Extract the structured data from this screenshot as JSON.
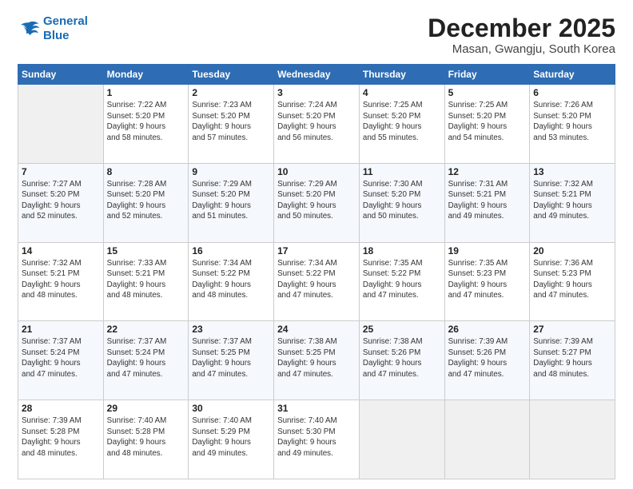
{
  "header": {
    "logo_line1": "General",
    "logo_line2": "Blue",
    "month": "December 2025",
    "location": "Masan, Gwangju, South Korea"
  },
  "days": [
    "Sunday",
    "Monday",
    "Tuesday",
    "Wednesday",
    "Thursday",
    "Friday",
    "Saturday"
  ],
  "weeks": [
    [
      {
        "date": "",
        "info": ""
      },
      {
        "date": "1",
        "info": "Sunrise: 7:22 AM\nSunset: 5:20 PM\nDaylight: 9 hours\nand 58 minutes."
      },
      {
        "date": "2",
        "info": "Sunrise: 7:23 AM\nSunset: 5:20 PM\nDaylight: 9 hours\nand 57 minutes."
      },
      {
        "date": "3",
        "info": "Sunrise: 7:24 AM\nSunset: 5:20 PM\nDaylight: 9 hours\nand 56 minutes."
      },
      {
        "date": "4",
        "info": "Sunrise: 7:25 AM\nSunset: 5:20 PM\nDaylight: 9 hours\nand 55 minutes."
      },
      {
        "date": "5",
        "info": "Sunrise: 7:25 AM\nSunset: 5:20 PM\nDaylight: 9 hours\nand 54 minutes."
      },
      {
        "date": "6",
        "info": "Sunrise: 7:26 AM\nSunset: 5:20 PM\nDaylight: 9 hours\nand 53 minutes."
      }
    ],
    [
      {
        "date": "7",
        "info": "Sunrise: 7:27 AM\nSunset: 5:20 PM\nDaylight: 9 hours\nand 52 minutes."
      },
      {
        "date": "8",
        "info": "Sunrise: 7:28 AM\nSunset: 5:20 PM\nDaylight: 9 hours\nand 52 minutes."
      },
      {
        "date": "9",
        "info": "Sunrise: 7:29 AM\nSunset: 5:20 PM\nDaylight: 9 hours\nand 51 minutes."
      },
      {
        "date": "10",
        "info": "Sunrise: 7:29 AM\nSunset: 5:20 PM\nDaylight: 9 hours\nand 50 minutes."
      },
      {
        "date": "11",
        "info": "Sunrise: 7:30 AM\nSunset: 5:20 PM\nDaylight: 9 hours\nand 50 minutes."
      },
      {
        "date": "12",
        "info": "Sunrise: 7:31 AM\nSunset: 5:21 PM\nDaylight: 9 hours\nand 49 minutes."
      },
      {
        "date": "13",
        "info": "Sunrise: 7:32 AM\nSunset: 5:21 PM\nDaylight: 9 hours\nand 49 minutes."
      }
    ],
    [
      {
        "date": "14",
        "info": "Sunrise: 7:32 AM\nSunset: 5:21 PM\nDaylight: 9 hours\nand 48 minutes."
      },
      {
        "date": "15",
        "info": "Sunrise: 7:33 AM\nSunset: 5:21 PM\nDaylight: 9 hours\nand 48 minutes."
      },
      {
        "date": "16",
        "info": "Sunrise: 7:34 AM\nSunset: 5:22 PM\nDaylight: 9 hours\nand 48 minutes."
      },
      {
        "date": "17",
        "info": "Sunrise: 7:34 AM\nSunset: 5:22 PM\nDaylight: 9 hours\nand 47 minutes."
      },
      {
        "date": "18",
        "info": "Sunrise: 7:35 AM\nSunset: 5:22 PM\nDaylight: 9 hours\nand 47 minutes."
      },
      {
        "date": "19",
        "info": "Sunrise: 7:35 AM\nSunset: 5:23 PM\nDaylight: 9 hours\nand 47 minutes."
      },
      {
        "date": "20",
        "info": "Sunrise: 7:36 AM\nSunset: 5:23 PM\nDaylight: 9 hours\nand 47 minutes."
      }
    ],
    [
      {
        "date": "21",
        "info": "Sunrise: 7:37 AM\nSunset: 5:24 PM\nDaylight: 9 hours\nand 47 minutes."
      },
      {
        "date": "22",
        "info": "Sunrise: 7:37 AM\nSunset: 5:24 PM\nDaylight: 9 hours\nand 47 minutes."
      },
      {
        "date": "23",
        "info": "Sunrise: 7:37 AM\nSunset: 5:25 PM\nDaylight: 9 hours\nand 47 minutes."
      },
      {
        "date": "24",
        "info": "Sunrise: 7:38 AM\nSunset: 5:25 PM\nDaylight: 9 hours\nand 47 minutes."
      },
      {
        "date": "25",
        "info": "Sunrise: 7:38 AM\nSunset: 5:26 PM\nDaylight: 9 hours\nand 47 minutes."
      },
      {
        "date": "26",
        "info": "Sunrise: 7:39 AM\nSunset: 5:26 PM\nDaylight: 9 hours\nand 47 minutes."
      },
      {
        "date": "27",
        "info": "Sunrise: 7:39 AM\nSunset: 5:27 PM\nDaylight: 9 hours\nand 48 minutes."
      }
    ],
    [
      {
        "date": "28",
        "info": "Sunrise: 7:39 AM\nSunset: 5:28 PM\nDaylight: 9 hours\nand 48 minutes."
      },
      {
        "date": "29",
        "info": "Sunrise: 7:40 AM\nSunset: 5:28 PM\nDaylight: 9 hours\nand 48 minutes."
      },
      {
        "date": "30",
        "info": "Sunrise: 7:40 AM\nSunset: 5:29 PM\nDaylight: 9 hours\nand 49 minutes."
      },
      {
        "date": "31",
        "info": "Sunrise: 7:40 AM\nSunset: 5:30 PM\nDaylight: 9 hours\nand 49 minutes."
      },
      {
        "date": "",
        "info": ""
      },
      {
        "date": "",
        "info": ""
      },
      {
        "date": "",
        "info": ""
      }
    ]
  ]
}
